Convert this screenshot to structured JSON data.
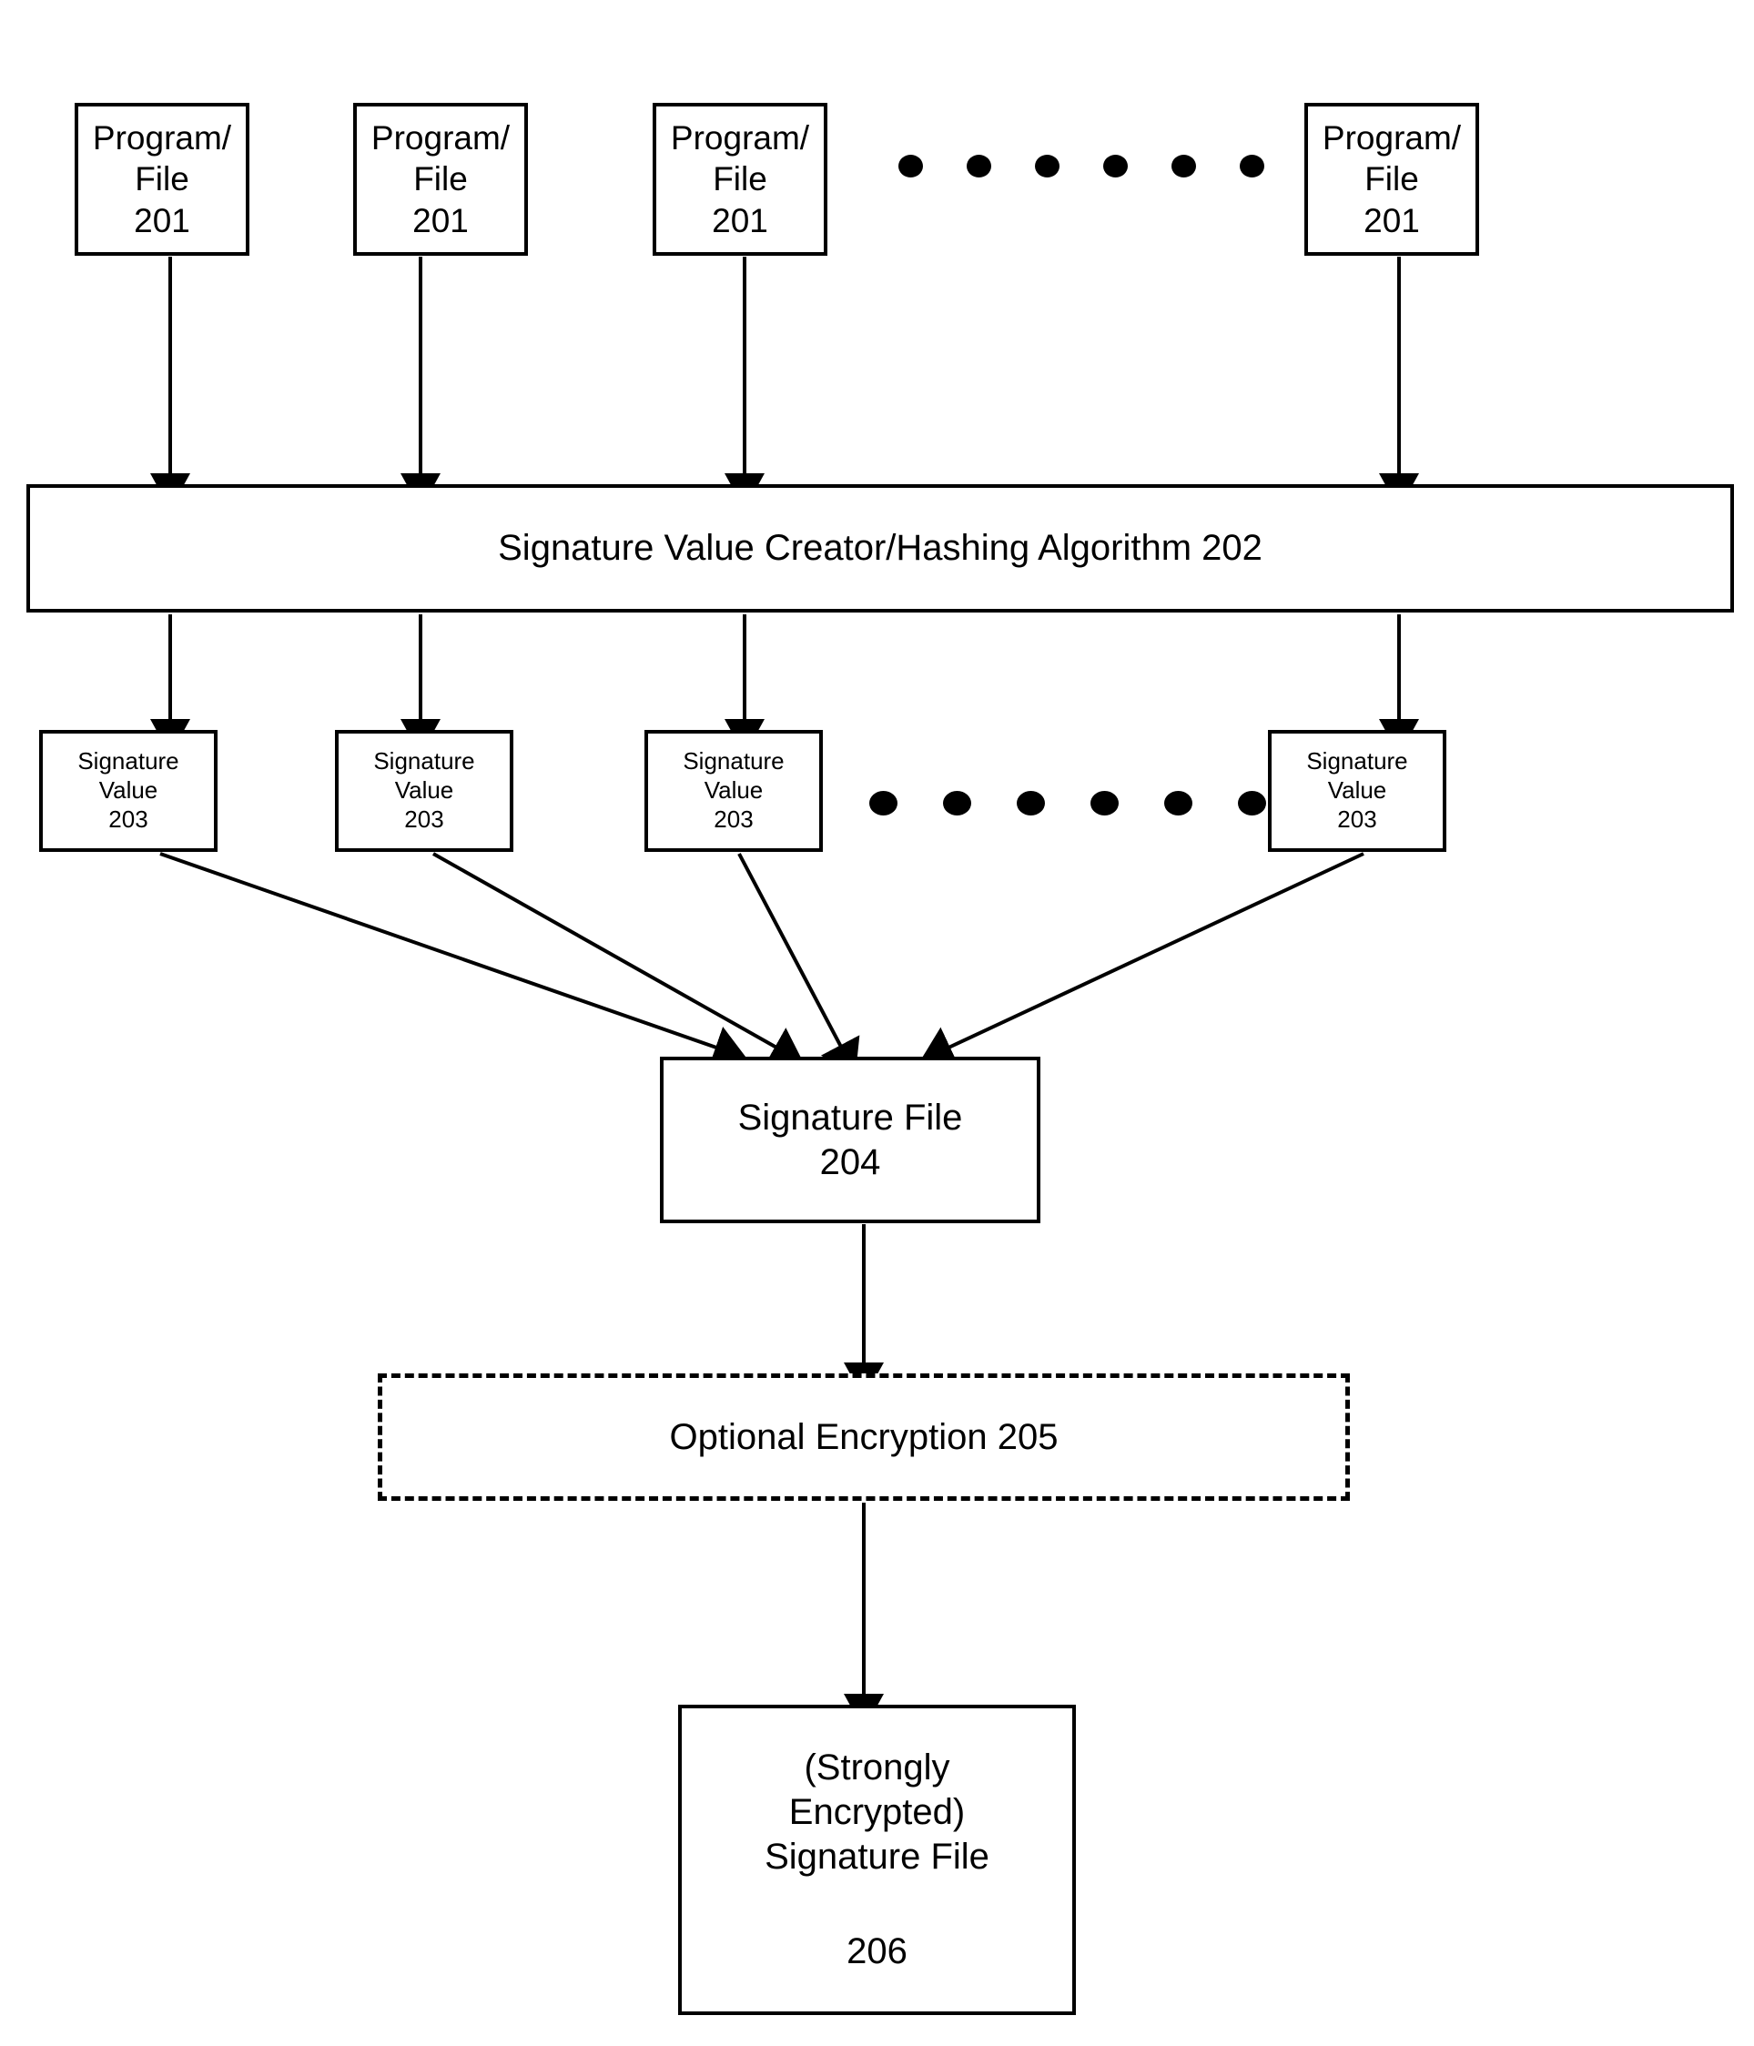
{
  "figure": {
    "title": "Signature file creation flow diagram",
    "background_color": "#ffffff",
    "stroke_color": "#000000"
  },
  "nodes": {
    "program_files": [
      {
        "line1": "Program/",
        "line2": "File",
        "line3": "201"
      },
      {
        "line1": "Program/",
        "line2": "File",
        "line3": "201"
      },
      {
        "line1": "Program/",
        "line2": "File",
        "line3": "201"
      },
      {
        "line1": "Program/",
        "line2": "File",
        "line3": "201"
      }
    ],
    "hashing_bar": {
      "label": "Signature Value Creator/Hashing Algorithm 202"
    },
    "signature_values": [
      {
        "line1": "Signature",
        "line2": "Value",
        "line3": "203"
      },
      {
        "line1": "Signature",
        "line2": "Value",
        "line3": "203"
      },
      {
        "line1": "Signature",
        "line2": "Value",
        "line3": "203"
      },
      {
        "line1": "Signature",
        "line2": "Value",
        "line3": "203"
      }
    ],
    "signature_file": {
      "line1": "Signature File",
      "line2": "204"
    },
    "optional_encryption": {
      "label": "Optional Encryption 205"
    },
    "encrypted_signature_file": {
      "line1": "(Strongly",
      "line2": "Encrypted)",
      "line3": "Signature File",
      "line4": "206"
    }
  },
  "ellipses": {
    "top_row_dot_count": 6,
    "second_row_dot_count": 6
  }
}
